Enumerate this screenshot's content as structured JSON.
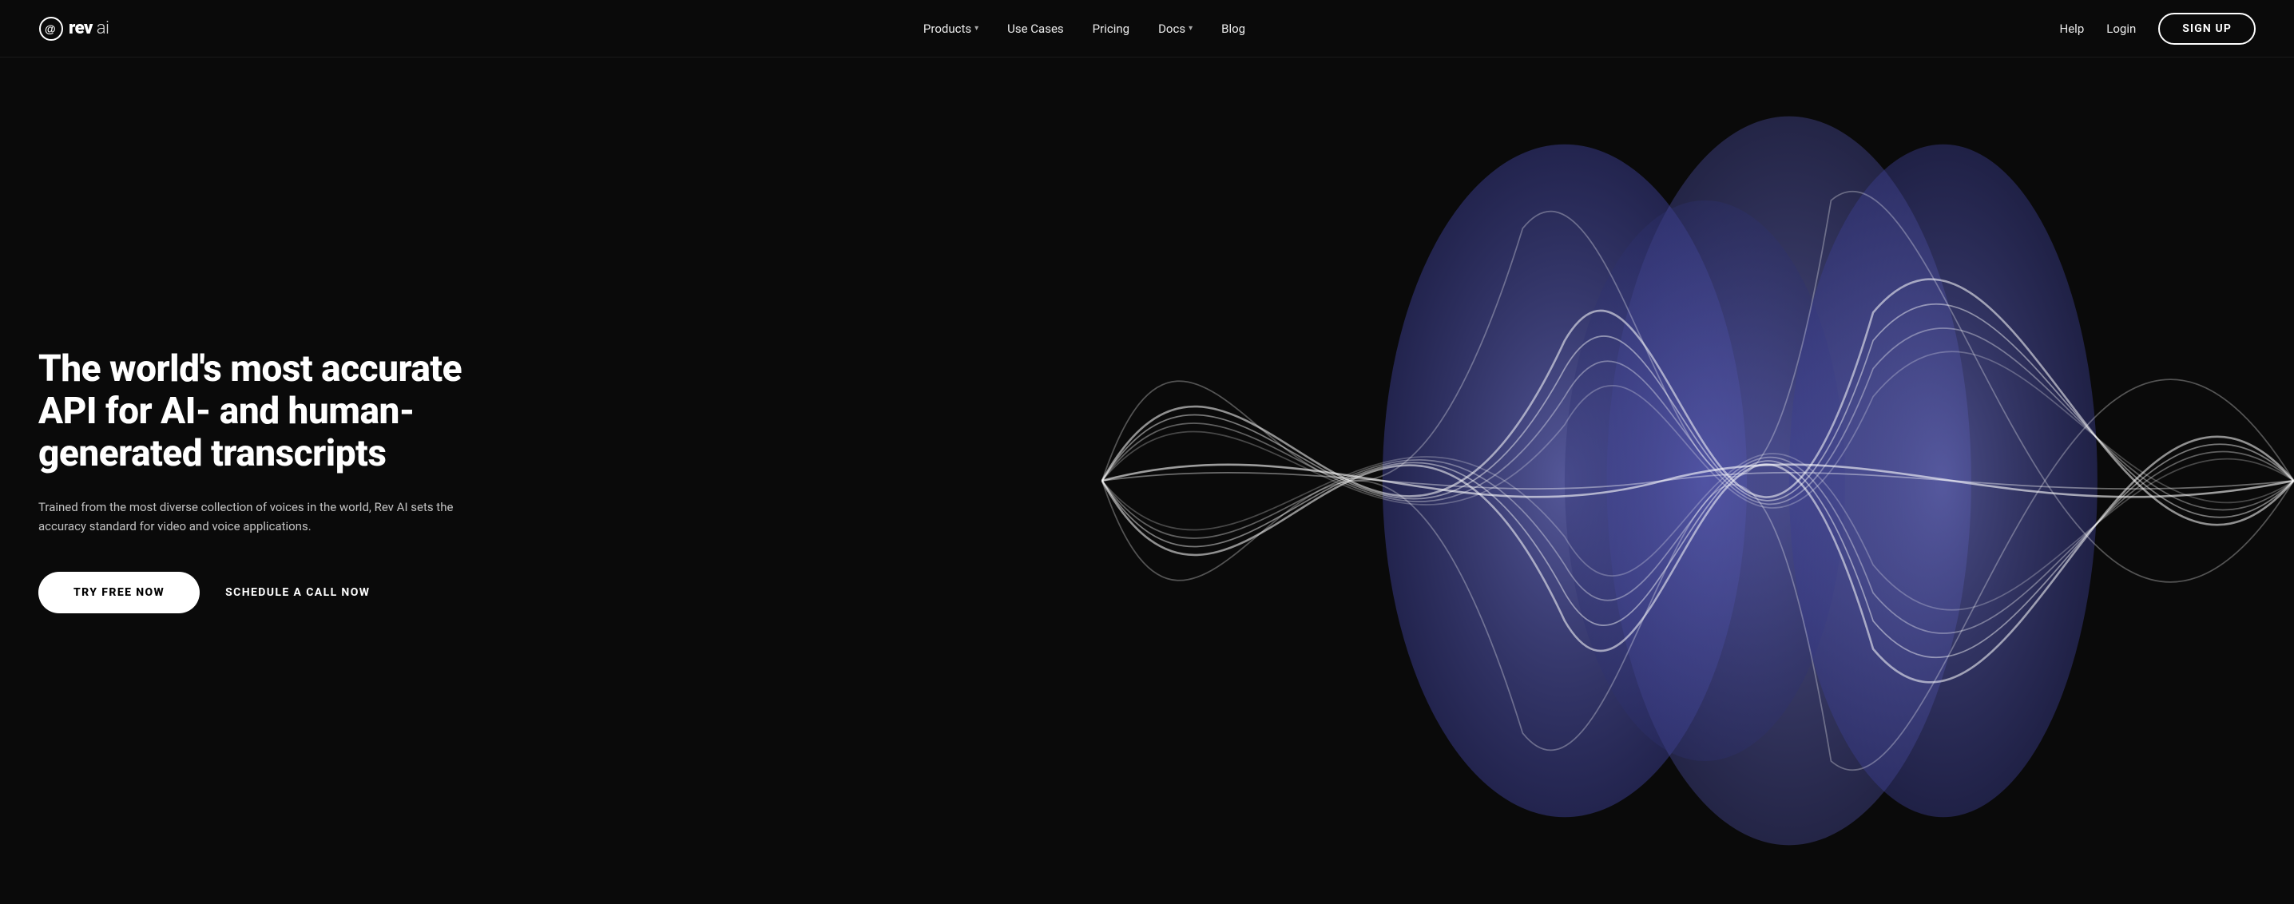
{
  "logo": {
    "symbol": "@",
    "name_bold": "rev",
    "name_light": " ai"
  },
  "navbar": {
    "center_items": [
      {
        "label": "Products",
        "has_dropdown": true
      },
      {
        "label": "Use Cases",
        "has_dropdown": false
      },
      {
        "label": "Pricing",
        "has_dropdown": false
      },
      {
        "label": "Docs",
        "has_dropdown": true
      },
      {
        "label": "Blog",
        "has_dropdown": false
      }
    ],
    "right_items": [
      {
        "label": "Help"
      },
      {
        "label": "Login"
      }
    ],
    "signup_label": "SIGN UP"
  },
  "hero": {
    "title": "The world's most accurate API for AI- and human-generated transcripts",
    "description": "Trained from the most diverse collection of voices in the world, Rev AI sets the accuracy standard for video and voice applications.",
    "btn_try": "TRY FREE NOW",
    "btn_schedule": "SCHEDULE A CALL NOW"
  },
  "colors": {
    "background": "#0a0a0a",
    "wave_primary": "#5a5eb8",
    "wave_secondary": "#7b7fd4",
    "wave_lines": "rgba(255,255,255,0.6)"
  }
}
